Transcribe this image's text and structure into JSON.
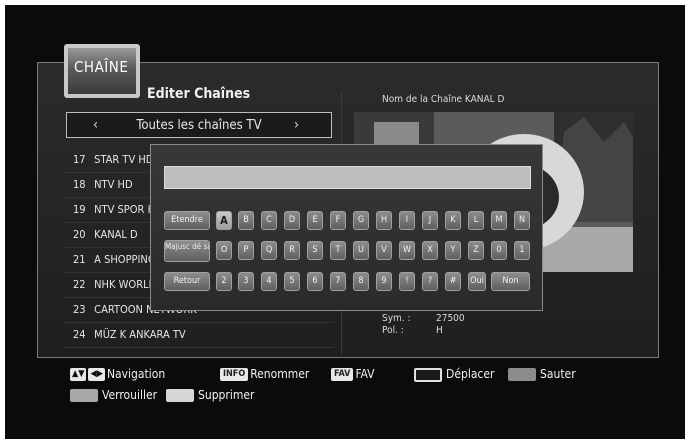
{
  "header": {
    "badge": "CHAÎNE",
    "title": "Editer Chaînes"
  },
  "selector": {
    "left_arrow": "‹",
    "label": "Toutes les chaînes TV",
    "right_arrow": "›"
  },
  "channels": [
    {
      "num": "17",
      "name": "STAR TV HD"
    },
    {
      "num": "18",
      "name": "NTV HD"
    },
    {
      "num": "19",
      "name": "NTV SPOR HD"
    },
    {
      "num": "20",
      "name": "KANAL D"
    },
    {
      "num": "21",
      "name": "A SHOPPING"
    },
    {
      "num": "22",
      "name": "NHK WORLD"
    },
    {
      "num": "23",
      "name": "CARTOON NETWORK"
    },
    {
      "num": "24",
      "name": "MÜZ K ANKARA TV"
    }
  ],
  "info": {
    "channel_name": "Nom de la Chaîne  KANAL D",
    "sym_label": "Sym. :",
    "sym_value": "27500",
    "pol_label": "Pol. :",
    "pol_value": "H"
  },
  "keyboard": {
    "input_value": "",
    "row1": {
      "func": "Etendre",
      "keys": [
        "A",
        "B",
        "C",
        "D",
        "E",
        "F",
        "G",
        "H",
        "I",
        "J",
        "K",
        "L",
        "M",
        "N"
      ]
    },
    "row2": {
      "func": "Majusc dé sactivé",
      "keys": [
        "O",
        "P",
        "Q",
        "R",
        "S",
        "T",
        "U",
        "V",
        "W",
        "X",
        "Y",
        "Z",
        "0",
        "1"
      ]
    },
    "row3": {
      "func": "Retour",
      "keys": [
        "2",
        "3",
        "4",
        "5",
        "6",
        "7",
        "8",
        "9",
        "!",
        "?",
        "#",
        "Oui"
      ],
      "last": "Non"
    }
  },
  "legend": {
    "nav": "Navigation",
    "info_tag": "INFO",
    "rename": "Renommer",
    "fav_tag": "FAV",
    "fav": "FAV",
    "move": "Déplacer",
    "skip": "Sauter",
    "lock": "Verrouiller",
    "delete": "Supprimer"
  },
  "colors": {
    "move_key": "#1a1a1a",
    "skip_key": "#8c8c8c",
    "lock_key": "#a8a8a8",
    "delete_key": "#d6d6d6"
  }
}
